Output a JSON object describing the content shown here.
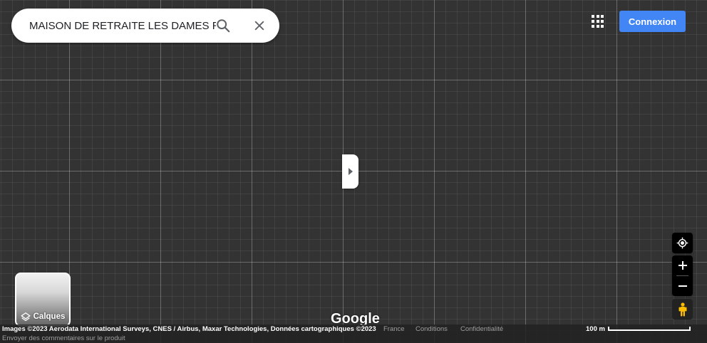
{
  "search": {
    "value": "MAISON DE RETRAITE LES DAMES R",
    "search_icon": "search-icon",
    "clear_icon": "close-icon"
  },
  "header": {
    "apps_icon": "apps-grid-icon",
    "signin_label": "Connexion"
  },
  "side_panel": {
    "toggle_icon": "caret-right-icon"
  },
  "layers": {
    "label": "Calques",
    "icon": "layers-icon"
  },
  "controls": {
    "locate_icon": "my-location-icon",
    "zoom_in_icon": "plus-icon",
    "zoom_out_icon": "minus-icon",
    "pegman_icon": "pegman-icon"
  },
  "logo": "Google",
  "footer": {
    "attribution": "Images ©2023 Aerodata International Surveys, CNES / Airbus, Maxar Technologies, Données cartographiques ©2023",
    "country": "France",
    "terms": "Conditions",
    "privacy": "Confidentialité",
    "feedback": "Envoyer des commentaires sur le produit",
    "scale": "100 m"
  },
  "colors": {
    "map_background": "#333333",
    "signin_button": "#4285f4"
  }
}
